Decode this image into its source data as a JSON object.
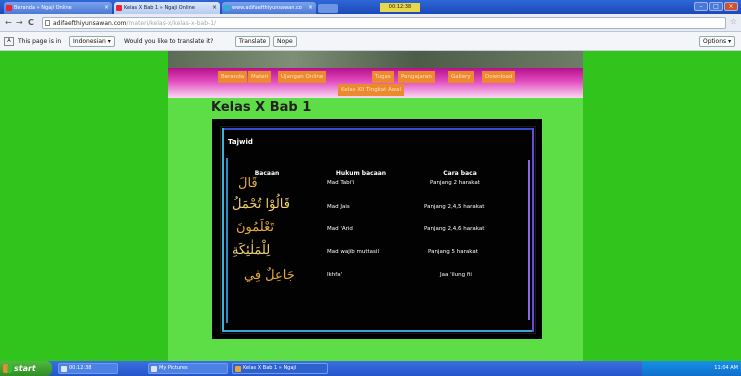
{
  "browser": {
    "tabs": [
      {
        "label": "Beranda » Ngaji Online",
        "active": false
      },
      {
        "label": "Kelas X Bab 1 » Ngaji Online",
        "active": true
      },
      {
        "label": "www.adifaefthiyunsawan.co",
        "active": false
      }
    ],
    "clock_top": "00:12:38",
    "url_host": "adifaefthiyunsawan.com",
    "url_path": "/materi/kelas-x/kelas-x-bab-1/",
    "translate": {
      "prefix": "This page is in",
      "language": "Indonesian",
      "question": "Would you like to translate it?",
      "translate_btn": "Translate",
      "nope_btn": "Nope",
      "options_btn": "Options"
    }
  },
  "site": {
    "menu_row1": [
      "Beranda",
      "Materi",
      "Ujangan Online",
      "Tugas",
      "Pengajaran",
      "Gallery",
      "Download"
    ],
    "menu_row2": [
      "Kelas XII Tingkat Awal"
    ],
    "page_title": "Kelas X Bab 1"
  },
  "tajwid": {
    "title": "Tajwid",
    "headers": {
      "bacaan": "Bacaan",
      "hukum": "Hukum bacaan",
      "cara": "Cara baca"
    },
    "rows": [
      {
        "arabic": "قَالَ",
        "hukum": "Mad Tabi'i",
        "cara": "Panjang 2 harakat"
      },
      {
        "arabic": "قَالُوْا تُحْمَلُ",
        "hukum": "Mad Jais",
        "cara": "Panjang 2,4,5 harakat"
      },
      {
        "arabic": "تَعْلَمُونَ",
        "hukum": "Mad 'Arid",
        "cara": "Panjang 2,4,6 harakat"
      },
      {
        "arabic": "لِلْمَلٰئِكَةِ",
        "hukum": "Mad wajib muttasil",
        "cara": "Panjang 5  harakat"
      },
      {
        "arabic": "جَاعِلٌ فِي",
        "hukum": "Ikhfa'",
        "cara": "Jaa 'ilung fii"
      }
    ]
  },
  "taskbar": {
    "start": "start",
    "tasks": [
      "00:12:38",
      "My Pictures",
      "Kelas X Bab 1 » Ngaji"
    ],
    "tray_time": "11:04 AM"
  },
  "colors": {
    "page_green": "#31c41c",
    "content_green": "#5ede46",
    "menu_orange": "#ee8a2e"
  }
}
